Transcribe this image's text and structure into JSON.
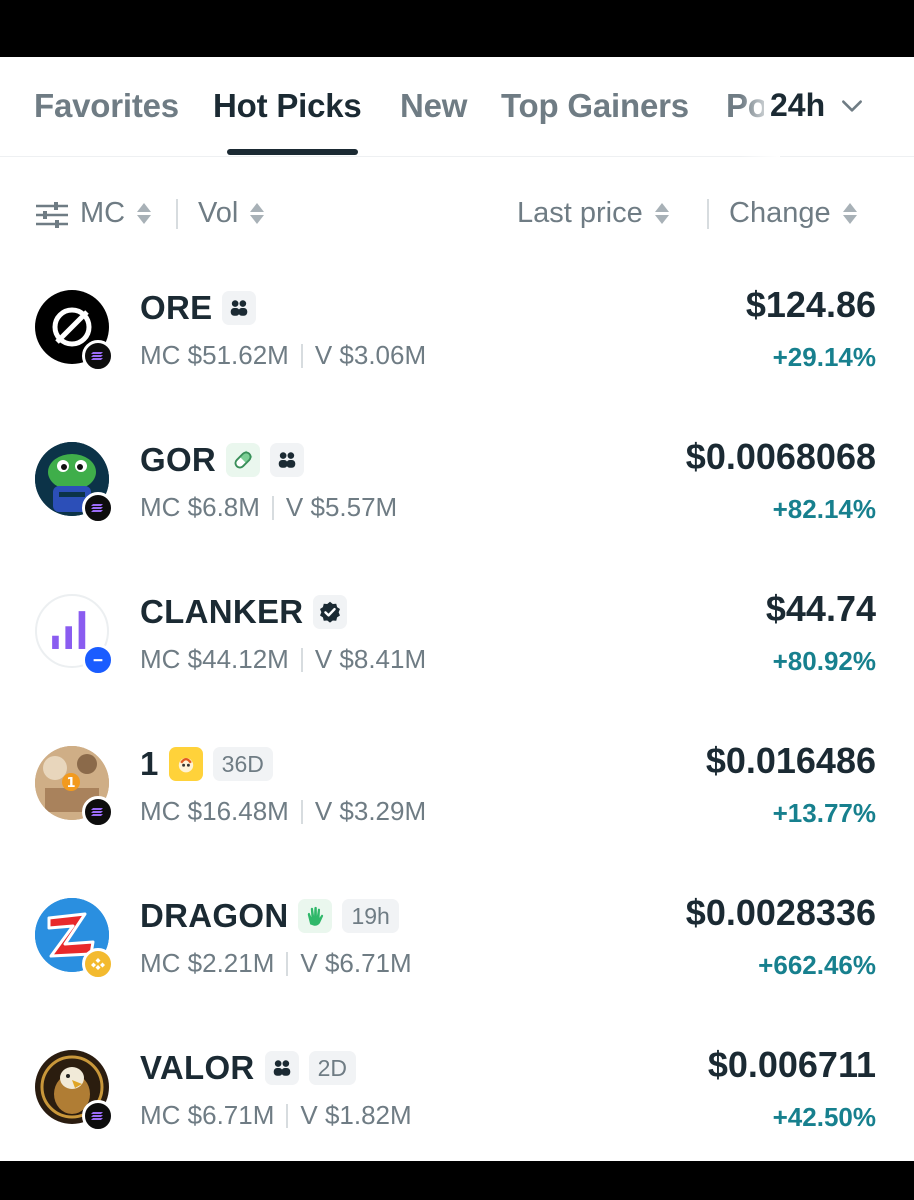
{
  "tabs": [
    {
      "label": "Favorites",
      "active": false
    },
    {
      "label": "Hot Picks",
      "active": true
    },
    {
      "label": "New",
      "active": false
    },
    {
      "label": "Top Gainers",
      "active": false
    },
    {
      "label": "Po",
      "active": false
    }
  ],
  "period": {
    "label": "24h",
    "icon": "chevron-down-icon"
  },
  "sort": {
    "filter_icon": "sliders-icon",
    "mc": "MC",
    "vol": "Vol",
    "last_price": "Last price",
    "change": "Change"
  },
  "tokens": [
    {
      "name": "ORE",
      "mc": "MC $51.62M",
      "vol": "V $3.06M",
      "price": "$124.86",
      "change": "+29.14%",
      "age": "",
      "badges": [
        "community-icon"
      ],
      "chain": "solana-icon"
    },
    {
      "name": "GOR",
      "mc": "MC $6.8M",
      "vol": "V $5.57M",
      "price": "$0.0068068",
      "change": "+82.14%",
      "age": "",
      "badges": [
        "pill-icon",
        "community-icon"
      ],
      "chain": "solana-icon"
    },
    {
      "name": "CLANKER",
      "mc": "MC $44.12M",
      "vol": "V $8.41M",
      "price": "$44.74",
      "change": "+80.92%",
      "age": "",
      "badges": [
        "verified-icon"
      ],
      "chain": "base-icon"
    },
    {
      "name": "1",
      "mc": "MC $16.48M",
      "vol": "V $3.29M",
      "price": "$0.016486",
      "change": "+13.77%",
      "age": "36D",
      "badges": [
        "launchpad-icon"
      ],
      "chain": "solana-icon"
    },
    {
      "name": "DRAGON",
      "mc": "MC $2.21M",
      "vol": "V $6.71M",
      "price": "$0.0028336",
      "change": "+662.46%",
      "age": "19h",
      "badges": [
        "wave-hand-icon"
      ],
      "chain": "bnb-icon"
    },
    {
      "name": "VALOR",
      "mc": "MC $6.71M",
      "vol": "V $1.82M",
      "price": "$0.006711",
      "change": "+42.50%",
      "age": "2D",
      "badges": [
        "community-icon"
      ],
      "chain": "solana-icon"
    }
  ],
  "colors": {
    "text": "#1b2a33",
    "muted": "#6f7c84",
    "positive": "#17808e"
  }
}
